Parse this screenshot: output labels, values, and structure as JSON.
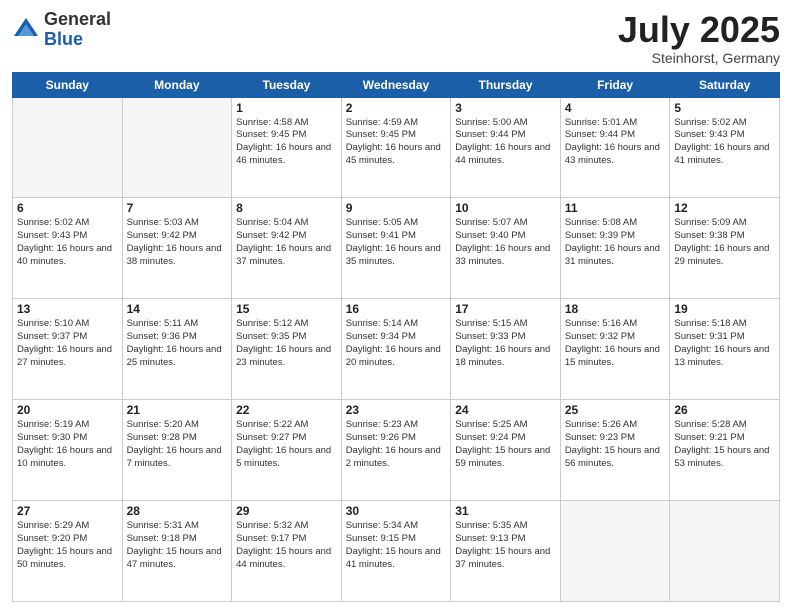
{
  "header": {
    "logo_general": "General",
    "logo_blue": "Blue",
    "title": "July 2025",
    "subtitle": "Steinhorst, Germany"
  },
  "days_of_week": [
    "Sunday",
    "Monday",
    "Tuesday",
    "Wednesday",
    "Thursday",
    "Friday",
    "Saturday"
  ],
  "weeks": [
    [
      {
        "day": "",
        "info": ""
      },
      {
        "day": "",
        "info": ""
      },
      {
        "day": "1",
        "info": "Sunrise: 4:58 AM\nSunset: 9:45 PM\nDaylight: 16 hours\nand 46 minutes."
      },
      {
        "day": "2",
        "info": "Sunrise: 4:59 AM\nSunset: 9:45 PM\nDaylight: 16 hours\nand 45 minutes."
      },
      {
        "day": "3",
        "info": "Sunrise: 5:00 AM\nSunset: 9:44 PM\nDaylight: 16 hours\nand 44 minutes."
      },
      {
        "day": "4",
        "info": "Sunrise: 5:01 AM\nSunset: 9:44 PM\nDaylight: 16 hours\nand 43 minutes."
      },
      {
        "day": "5",
        "info": "Sunrise: 5:02 AM\nSunset: 9:43 PM\nDaylight: 16 hours\nand 41 minutes."
      }
    ],
    [
      {
        "day": "6",
        "info": "Sunrise: 5:02 AM\nSunset: 9:43 PM\nDaylight: 16 hours\nand 40 minutes."
      },
      {
        "day": "7",
        "info": "Sunrise: 5:03 AM\nSunset: 9:42 PM\nDaylight: 16 hours\nand 38 minutes."
      },
      {
        "day": "8",
        "info": "Sunrise: 5:04 AM\nSunset: 9:42 PM\nDaylight: 16 hours\nand 37 minutes."
      },
      {
        "day": "9",
        "info": "Sunrise: 5:05 AM\nSunset: 9:41 PM\nDaylight: 16 hours\nand 35 minutes."
      },
      {
        "day": "10",
        "info": "Sunrise: 5:07 AM\nSunset: 9:40 PM\nDaylight: 16 hours\nand 33 minutes."
      },
      {
        "day": "11",
        "info": "Sunrise: 5:08 AM\nSunset: 9:39 PM\nDaylight: 16 hours\nand 31 minutes."
      },
      {
        "day": "12",
        "info": "Sunrise: 5:09 AM\nSunset: 9:38 PM\nDaylight: 16 hours\nand 29 minutes."
      }
    ],
    [
      {
        "day": "13",
        "info": "Sunrise: 5:10 AM\nSunset: 9:37 PM\nDaylight: 16 hours\nand 27 minutes."
      },
      {
        "day": "14",
        "info": "Sunrise: 5:11 AM\nSunset: 9:36 PM\nDaylight: 16 hours\nand 25 minutes."
      },
      {
        "day": "15",
        "info": "Sunrise: 5:12 AM\nSunset: 9:35 PM\nDaylight: 16 hours\nand 23 minutes."
      },
      {
        "day": "16",
        "info": "Sunrise: 5:14 AM\nSunset: 9:34 PM\nDaylight: 16 hours\nand 20 minutes."
      },
      {
        "day": "17",
        "info": "Sunrise: 5:15 AM\nSunset: 9:33 PM\nDaylight: 16 hours\nand 18 minutes."
      },
      {
        "day": "18",
        "info": "Sunrise: 5:16 AM\nSunset: 9:32 PM\nDaylight: 16 hours\nand 15 minutes."
      },
      {
        "day": "19",
        "info": "Sunrise: 5:18 AM\nSunset: 9:31 PM\nDaylight: 16 hours\nand 13 minutes."
      }
    ],
    [
      {
        "day": "20",
        "info": "Sunrise: 5:19 AM\nSunset: 9:30 PM\nDaylight: 16 hours\nand 10 minutes."
      },
      {
        "day": "21",
        "info": "Sunrise: 5:20 AM\nSunset: 9:28 PM\nDaylight: 16 hours\nand 7 minutes."
      },
      {
        "day": "22",
        "info": "Sunrise: 5:22 AM\nSunset: 9:27 PM\nDaylight: 16 hours\nand 5 minutes."
      },
      {
        "day": "23",
        "info": "Sunrise: 5:23 AM\nSunset: 9:26 PM\nDaylight: 16 hours\nand 2 minutes."
      },
      {
        "day": "24",
        "info": "Sunrise: 5:25 AM\nSunset: 9:24 PM\nDaylight: 15 hours\nand 59 minutes."
      },
      {
        "day": "25",
        "info": "Sunrise: 5:26 AM\nSunset: 9:23 PM\nDaylight: 15 hours\nand 56 minutes."
      },
      {
        "day": "26",
        "info": "Sunrise: 5:28 AM\nSunset: 9:21 PM\nDaylight: 15 hours\nand 53 minutes."
      }
    ],
    [
      {
        "day": "27",
        "info": "Sunrise: 5:29 AM\nSunset: 9:20 PM\nDaylight: 15 hours\nand 50 minutes."
      },
      {
        "day": "28",
        "info": "Sunrise: 5:31 AM\nSunset: 9:18 PM\nDaylight: 15 hours\nand 47 minutes."
      },
      {
        "day": "29",
        "info": "Sunrise: 5:32 AM\nSunset: 9:17 PM\nDaylight: 15 hours\nand 44 minutes."
      },
      {
        "day": "30",
        "info": "Sunrise: 5:34 AM\nSunset: 9:15 PM\nDaylight: 15 hours\nand 41 minutes."
      },
      {
        "day": "31",
        "info": "Sunrise: 5:35 AM\nSunset: 9:13 PM\nDaylight: 15 hours\nand 37 minutes."
      },
      {
        "day": "",
        "info": ""
      },
      {
        "day": "",
        "info": ""
      }
    ]
  ]
}
